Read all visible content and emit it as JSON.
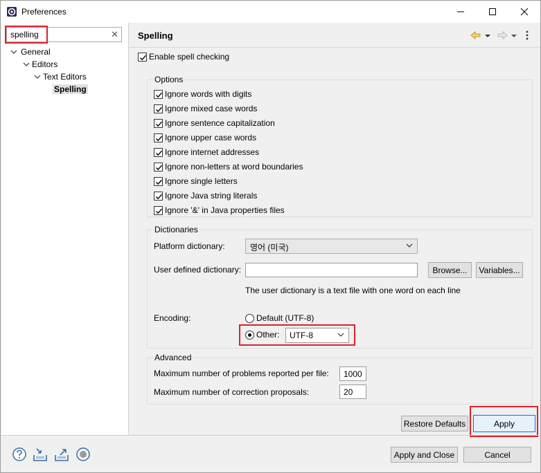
{
  "window": {
    "title": "Preferences",
    "icon": "eclipse-preferences-icon",
    "minimize_icon": "minimize-icon",
    "maximize_icon": "maximize-icon",
    "close_icon": "close-icon"
  },
  "sidebar": {
    "search": {
      "value": "spelling",
      "clear_icon": "clear-icon",
      "clear_glyph": "✕"
    },
    "tree": [
      {
        "label": "General",
        "level": 0,
        "expanded": true
      },
      {
        "label": "Editors",
        "level": 1,
        "expanded": true
      },
      {
        "label": "Text Editors",
        "level": 2,
        "expanded": true
      },
      {
        "label": "Spelling",
        "level": 3,
        "selected": true
      }
    ]
  },
  "page": {
    "title": "Spelling",
    "nav_icons": [
      "back-icon",
      "back-menu-icon",
      "forward-icon",
      "forward-menu-icon",
      "view-menu-icon"
    ],
    "enable_spell_checking": {
      "label": "Enable spell checking",
      "checked": true
    }
  },
  "options": {
    "title": "Options",
    "items": [
      {
        "label": "Ignore words with digits",
        "checked": true
      },
      {
        "label": "Ignore mixed case words",
        "checked": true
      },
      {
        "label": "Ignore sentence capitalization",
        "checked": true
      },
      {
        "label": "Ignore upper case words",
        "checked": true
      },
      {
        "label": "Ignore internet addresses",
        "checked": true
      },
      {
        "label": "Ignore non-letters at word boundaries",
        "checked": true
      },
      {
        "label": "Ignore single letters",
        "checked": true
      },
      {
        "label": "Ignore Java string literals",
        "checked": true
      },
      {
        "label": "Ignore '&' in Java properties files",
        "checked": true
      }
    ]
  },
  "dictionaries": {
    "title": "Dictionaries",
    "platform_label": "Platform dictionary:",
    "platform_value": "영어 (미국)",
    "user_label": "User defined dictionary:",
    "user_value": "",
    "browse_label": "Browse...",
    "variables_label": "Variables...",
    "info_text": "The user dictionary is a text file with one word on each line",
    "encoding_label": "Encoding:",
    "encoding_default_label": "Default (UTF-8)",
    "encoding_default_selected": false,
    "encoding_other_label": "Other:",
    "encoding_other_selected": true,
    "encoding_other_value": "UTF-8"
  },
  "advanced": {
    "title": "Advanced",
    "max_problems_label": "Maximum number of problems reported per file:",
    "max_problems_value": "1000",
    "max_proposals_label": "Maximum number of correction proposals:",
    "max_proposals_value": "20"
  },
  "buttons": {
    "restore_defaults": "Restore Defaults",
    "apply": "Apply",
    "apply_and_close": "Apply and Close",
    "cancel": "Cancel"
  },
  "footer_icons": [
    "help-icon",
    "import-icon",
    "export-icon",
    "record-icon"
  ],
  "colors": {
    "highlight": "#e0202a",
    "accent": "#0078d7"
  }
}
